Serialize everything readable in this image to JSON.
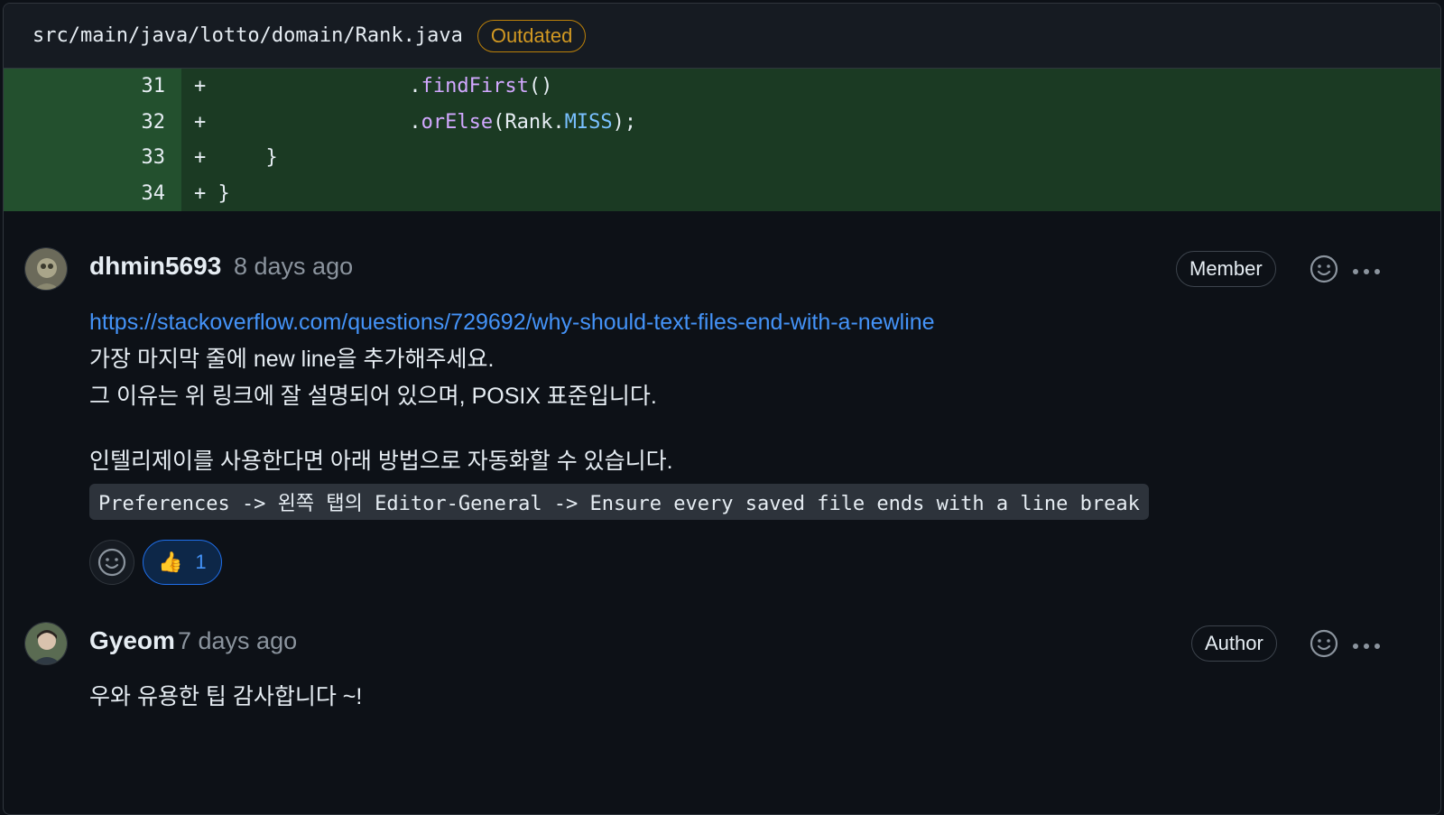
{
  "file": {
    "path": "src/main/java/lotto/domain/Rank.java",
    "status_badge": "Outdated"
  },
  "diff": {
    "lines": [
      {
        "num": "31",
        "sign": "+",
        "indent": "                ",
        "parts": [
          {
            "t": ".",
            "c": ""
          },
          {
            "t": "findFirst",
            "c": "fn"
          },
          {
            "t": "()",
            "c": ""
          }
        ]
      },
      {
        "num": "32",
        "sign": "+",
        "indent": "                ",
        "parts": [
          {
            "t": ".",
            "c": ""
          },
          {
            "t": "orElse",
            "c": "fn"
          },
          {
            "t": "(Rank.",
            "c": ""
          },
          {
            "t": "MISS",
            "c": "cst"
          },
          {
            "t": ");",
            "c": ""
          }
        ]
      },
      {
        "num": "33",
        "sign": "+",
        "indent": "    ",
        "parts": [
          {
            "t": "}",
            "c": ""
          }
        ]
      },
      {
        "num": "34",
        "sign": "+",
        "indent": "",
        "parts": [
          {
            "t": "}",
            "c": ""
          }
        ]
      }
    ]
  },
  "comments": [
    {
      "author": "dhmin5693",
      "time": "8 days ago",
      "role": "Member",
      "link": "https://stackoverflow.com/questions/729692/why-should-text-files-end-with-a-newline",
      "lines": [
        "가장 마지막 줄에 new line을 추가해주세요.",
        "그 이유는 위 링크에 잘 설명되어 있으며, POSIX 표준입니다."
      ],
      "para2": "인텔리제이를 사용한다면 아래 방법으로 자동화할 수 있습니다.",
      "code": "Preferences -> 왼쪽 탭의 Editor-General -> Ensure every saved file ends with a line break",
      "reaction": {
        "emoji": "👍",
        "count": "1"
      }
    },
    {
      "author": "Gyeom",
      "time": "7 days ago",
      "role": "Author",
      "text": "우와 유용한 팁 감사합니다 ~!"
    }
  ],
  "colors": {
    "accent_link": "#4493f8",
    "outdated": "#d29922",
    "diff_add_bg": "#1b3a23"
  }
}
